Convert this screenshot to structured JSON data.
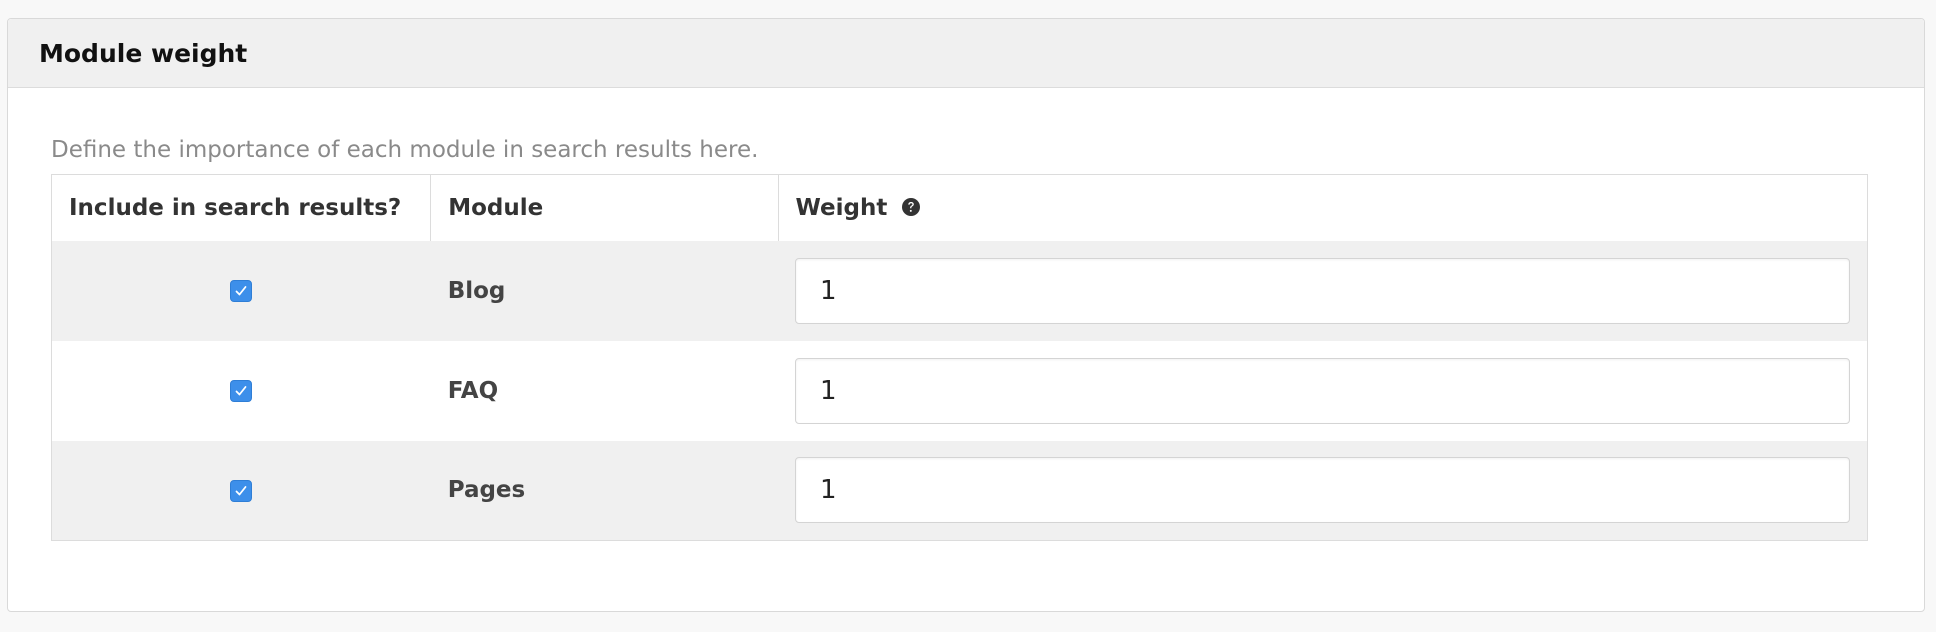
{
  "panel": {
    "title": "Module weight",
    "description": "Define the importance of each module in search results here."
  },
  "table": {
    "headers": {
      "include": "Include in search results?",
      "module": "Module",
      "weight": "Weight"
    },
    "weight_help_icon": "question-circle-icon",
    "rows": [
      {
        "included": true,
        "module": "Blog",
        "weight": "1"
      },
      {
        "included": true,
        "module": "FAQ",
        "weight": "1"
      },
      {
        "included": true,
        "module": "Pages",
        "weight": "1"
      }
    ]
  },
  "colors": {
    "checkbox": "#3d8fea",
    "heading_bg": "#f0f0f0",
    "stripe": "#f0f0f0"
  }
}
